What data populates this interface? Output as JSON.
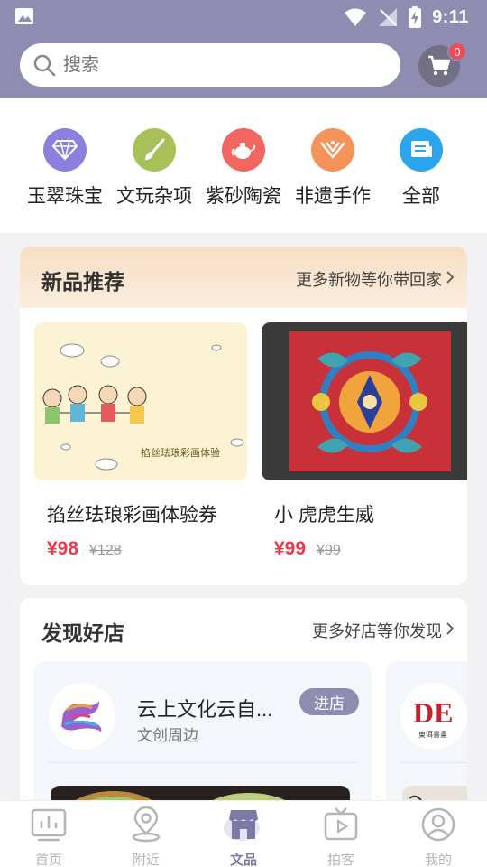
{
  "status_bar": {
    "time": "9:11"
  },
  "search": {
    "placeholder": "搜索"
  },
  "cart": {
    "badge": "0"
  },
  "categories": [
    {
      "label": "玉翠珠宝",
      "icon": "diamond-icon",
      "color": "#8b7fe0"
    },
    {
      "label": "文玩杂项",
      "icon": "brush-icon",
      "color": "#a7c05a"
    },
    {
      "label": "紫砂陶瓷",
      "icon": "teapot-icon",
      "color": "#f26661"
    },
    {
      "label": "非遗手作",
      "icon": "ornament-icon",
      "color": "#f4935a"
    },
    {
      "label": "全部",
      "icon": "list-icon",
      "color": "#2ba6ee"
    }
  ],
  "new_products": {
    "title": "新品推荐",
    "more": "更多新物等你带回家",
    "items": [
      {
        "name": "掐丝珐琅彩画体验券",
        "price": "¥98",
        "old_price": "¥128",
        "image_caption": "掐丝珐琅彩画体验"
      },
      {
        "name": "小 虎虎生威",
        "price": "¥99",
        "old_price": "¥99"
      }
    ]
  },
  "shops": {
    "title": "发现好店",
    "more": "更多好店等你发现",
    "items": [
      {
        "name": "云上文化云自...",
        "category": "文创周边",
        "button": "进店"
      },
      {
        "logo_text": "DE",
        "logo_caption": "東洱書畫"
      }
    ]
  },
  "nav": {
    "items": [
      {
        "label": "首页",
        "icon": "home-chart-icon",
        "active": false
      },
      {
        "label": "附近",
        "icon": "location-icon",
        "active": false
      },
      {
        "label": "文品",
        "icon": "shop-icon",
        "active": true
      },
      {
        "label": "拍客",
        "icon": "video-icon",
        "active": false
      },
      {
        "label": "我的",
        "icon": "profile-icon",
        "active": false
      }
    ]
  }
}
